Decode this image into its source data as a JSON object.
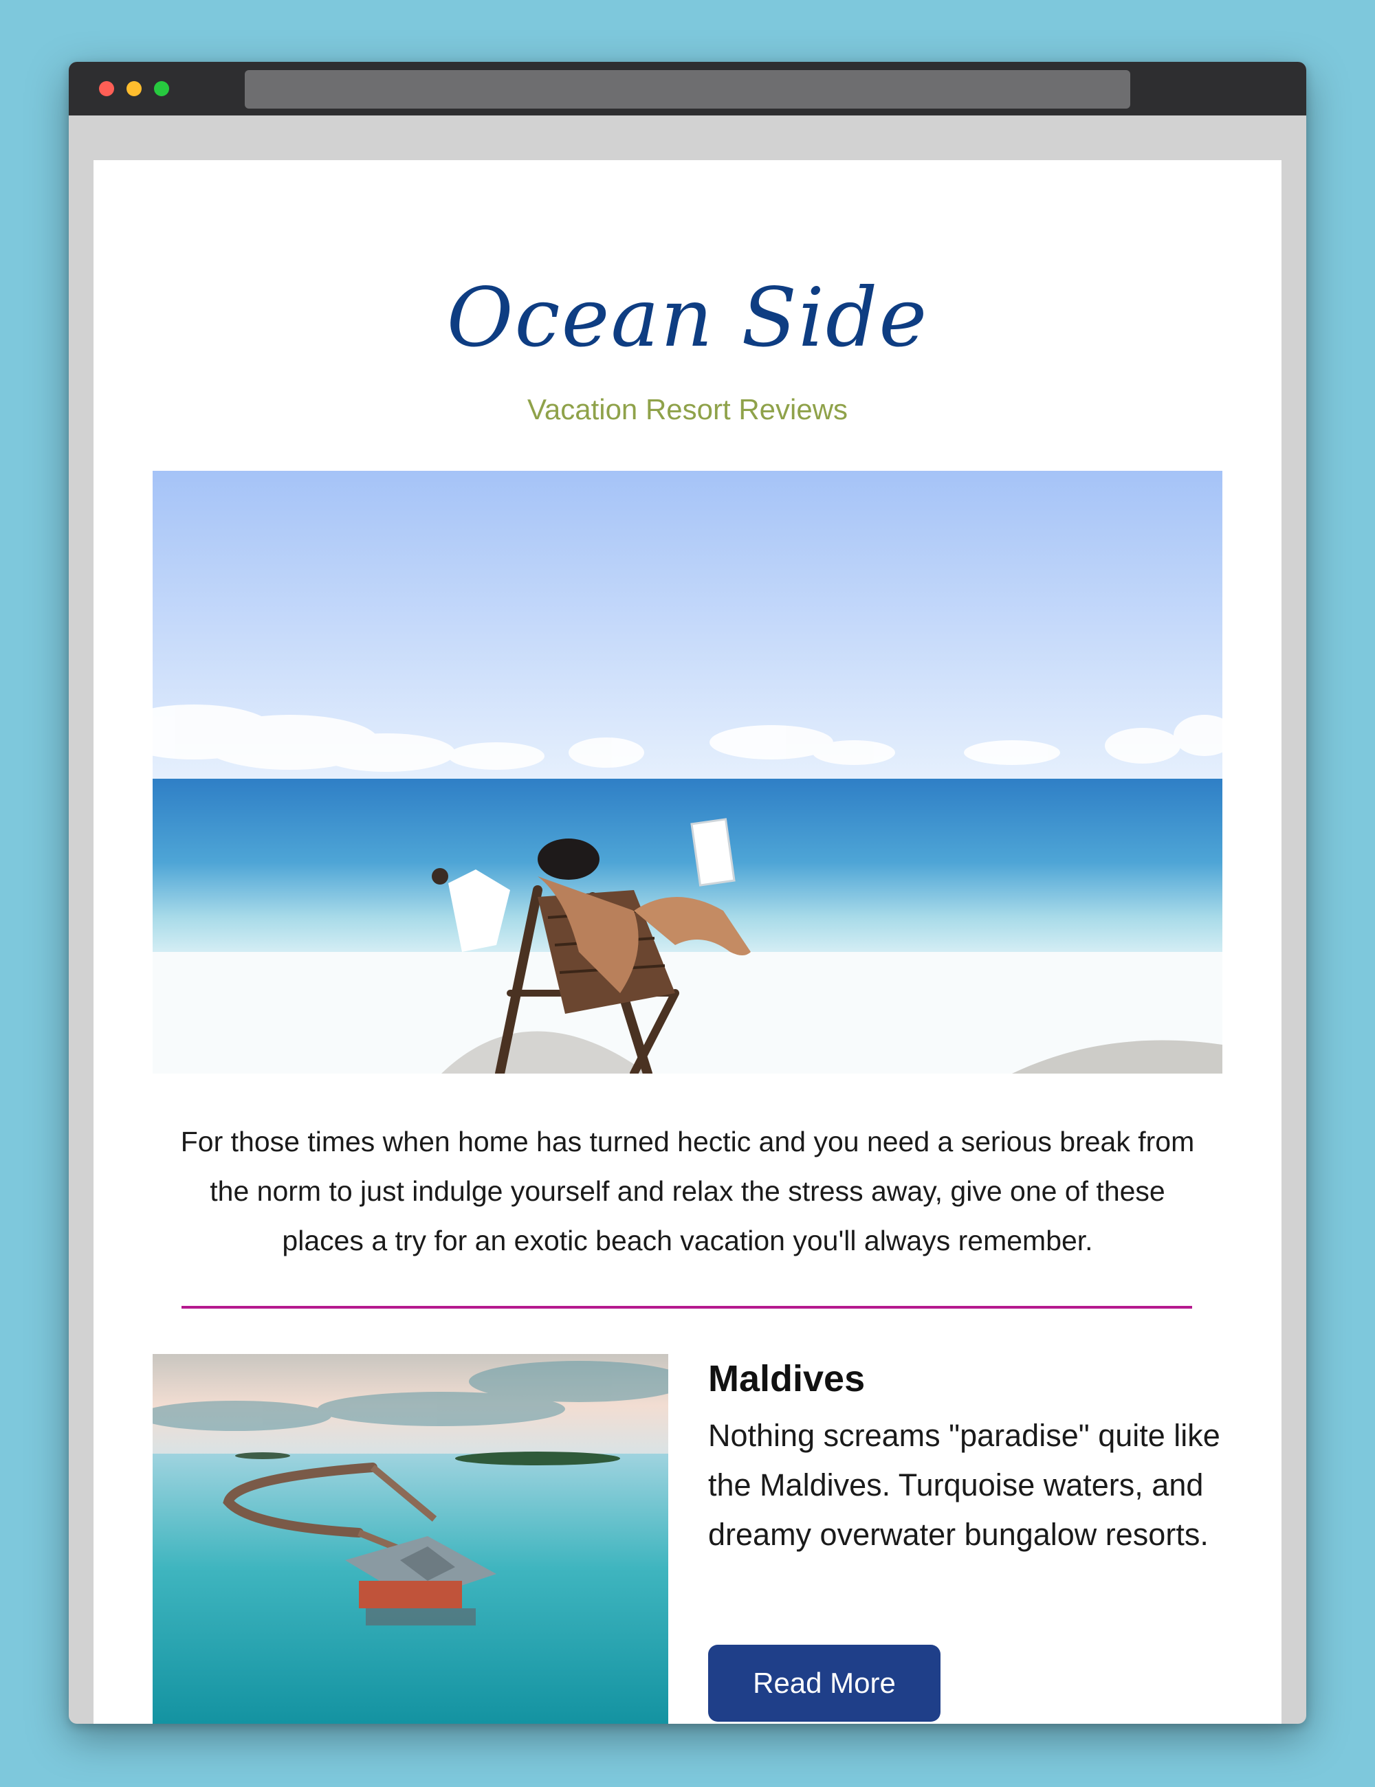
{
  "page": {
    "brand": "Ocean Side",
    "tagline": "Vacation Resort Reviews",
    "intro": "For those times when home has turned hectic and you need a serious break from the norm to just indulge yourself and relax the stress away, give one of these places a try for an exotic beach vacation you'll always remember."
  },
  "featured": {
    "title": "Maldives",
    "text": "Nothing screams \"paradise\" quite like the Maldives. Turquoise waters, and dreamy overwater bungalow resorts.",
    "button_label": "Read More"
  },
  "colors": {
    "brand": "#0e3d82",
    "tagline": "#8fa24a",
    "divider": "#b5198e",
    "button": "#1f3f89"
  },
  "icons": [
    "close-dot-icon",
    "minimize-dot-icon",
    "maximize-dot-icon"
  ]
}
